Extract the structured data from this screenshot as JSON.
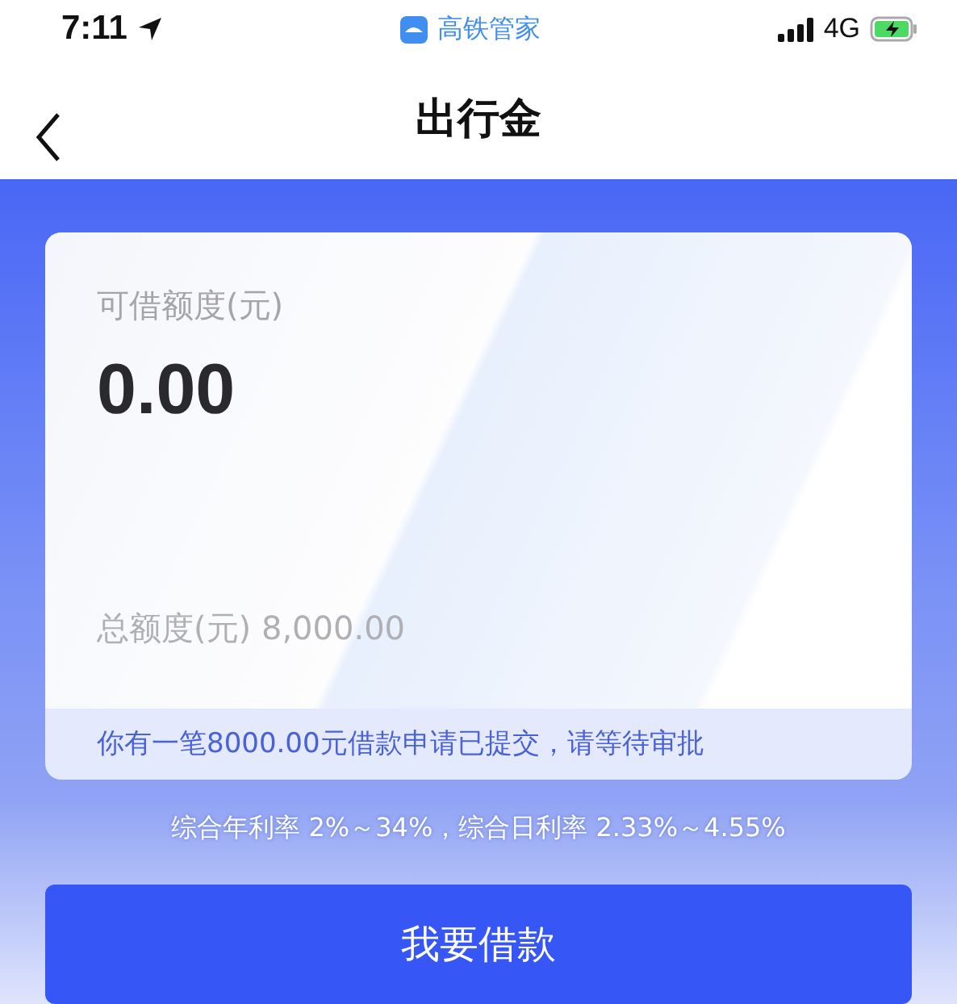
{
  "status_bar": {
    "time": "7:11",
    "app_name": "高铁管家",
    "network": "4G"
  },
  "nav": {
    "title": "出行金"
  },
  "card": {
    "available_label": "可借额度(元)",
    "available_amount": "0.00",
    "total_label": "总额度(元)",
    "total_amount": "8,000.00",
    "notice": "你有一笔8000.00元借款申请已提交，请等待审批"
  },
  "rates": "综合年利率 2%～34%，综合日利率 2.33%～4.55%",
  "button": {
    "label": "我要借款"
  }
}
